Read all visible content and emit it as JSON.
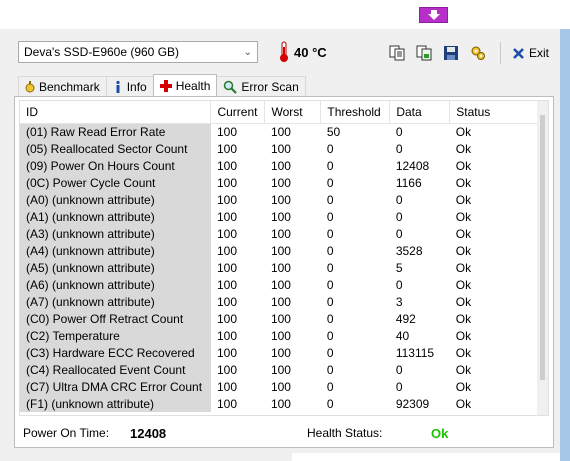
{
  "window": {
    "drive": "Deva's  SSD-E960e (960 GB)",
    "temperature": "40 °C",
    "exit_label": "Exit"
  },
  "tabs": [
    {
      "label": "Benchmark",
      "icon": "stopwatch-icon"
    },
    {
      "label": "Info",
      "icon": "info-icon"
    },
    {
      "label": "Health",
      "icon": "red-cross-icon",
      "active": true
    },
    {
      "label": "Error Scan",
      "icon": "magnifier-icon"
    }
  ],
  "table": {
    "headers": [
      "ID",
      "Current",
      "Worst",
      "Threshold",
      "Data",
      "Status"
    ],
    "rows": [
      [
        "(01) Raw Read Error Rate",
        "100",
        "100",
        "50",
        "0",
        "Ok"
      ],
      [
        "(05) Reallocated Sector Count",
        "100",
        "100",
        "0",
        "0",
        "Ok"
      ],
      [
        "(09) Power On Hours Count",
        "100",
        "100",
        "0",
        "12408",
        "Ok"
      ],
      [
        "(0C) Power Cycle Count",
        "100",
        "100",
        "0",
        "1166",
        "Ok"
      ],
      [
        "(A0) (unknown attribute)",
        "100",
        "100",
        "0",
        "0",
        "Ok"
      ],
      [
        "(A1) (unknown attribute)",
        "100",
        "100",
        "0",
        "0",
        "Ok"
      ],
      [
        "(A3) (unknown attribute)",
        "100",
        "100",
        "0",
        "0",
        "Ok"
      ],
      [
        "(A4) (unknown attribute)",
        "100",
        "100",
        "0",
        "3528",
        "Ok"
      ],
      [
        "(A5) (unknown attribute)",
        "100",
        "100",
        "0",
        "5",
        "Ok"
      ],
      [
        "(A6) (unknown attribute)",
        "100",
        "100",
        "0",
        "0",
        "Ok"
      ],
      [
        "(A7) (unknown attribute)",
        "100",
        "100",
        "0",
        "3",
        "Ok"
      ],
      [
        "(C0) Power Off Retract Count",
        "100",
        "100",
        "0",
        "492",
        "Ok"
      ],
      [
        "(C2) Temperature",
        "100",
        "100",
        "0",
        "40",
        "Ok"
      ],
      [
        "(C3) Hardware ECC Recovered",
        "100",
        "100",
        "0",
        "113115",
        "Ok"
      ],
      [
        "(C4) Reallocated Event Count",
        "100",
        "100",
        "0",
        "0",
        "Ok"
      ],
      [
        "(C7) Ultra DMA CRC Error Count",
        "100",
        "100",
        "0",
        "0",
        "Ok"
      ],
      [
        "(F1) (unknown attribute)",
        "100",
        "100",
        "0",
        "92309",
        "Ok"
      ]
    ]
  },
  "status": {
    "power_on_label": "Power On Time:",
    "power_on_value": "12408",
    "health_label": "Health Status:",
    "health_value": "Ok"
  },
  "colors": {
    "health_ok": "#19c400",
    "id_column_bg": "#d9d9d9"
  }
}
